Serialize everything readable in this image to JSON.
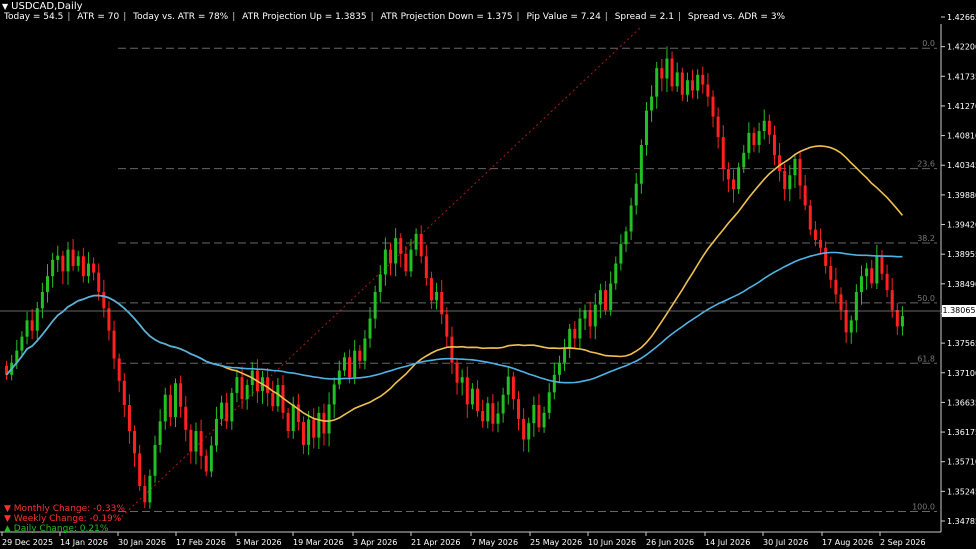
{
  "header": {
    "symbol_title": "USDCAD,Daily",
    "info": [
      "Today = 54.5",
      "ATR = 70",
      "Today vs. ATR = 78%",
      "ATR Projection Up = 1.3835",
      "ATR Projection Down = 1.375",
      "Pip Value = 7.24",
      "Spread = 2.1",
      "Spread vs. ADR = 3%"
    ]
  },
  "changes": {
    "monthly": "Monthly Change: -0.33%",
    "weekly": "Weekly Change: -0.19%",
    "daily": "Daily Change: 0.21%",
    "down_color": "#ff3030",
    "up_color": "#22bb22"
  },
  "current_price": "1.38065",
  "chart_data": {
    "type": "candlestick",
    "title": "USDCAD,Daily",
    "ylim": [
      1.3445,
      1.4295
    ],
    "y_ticks": [
      "1.42665",
      "1.42200",
      "1.41735",
      "1.41270",
      "1.40810",
      "1.40345",
      "1.39880",
      "1.39420",
      "1.38955",
      "1.38490",
      "1.38065",
      "1.37565",
      "1.37100",
      "1.36635",
      "1.36175",
      "1.35710",
      "1.35245",
      "1.34785"
    ],
    "x_labels": [
      "29 Dec 2025",
      "14 Jan 2026",
      "30 Jan 2026",
      "17 Feb 2026",
      "5 Mar 2026",
      "19 Mar 2026",
      "3 Apr 2026",
      "21 Apr 2026",
      "7 May 2026",
      "25 May 2026",
      "10 Jun 2026",
      "26 Jun 2026",
      "14 Jul 2026",
      "30 Jul 2026",
      "17 Aug 2026",
      "2 Sep 2026"
    ],
    "fib_levels": [
      {
        "label": "0.0",
        "price": 1.4245
      },
      {
        "label": "23.6",
        "price": 1.4046
      },
      {
        "label": "38.2",
        "price": 1.3923
      },
      {
        "label": "50.0",
        "price": 1.3824
      },
      {
        "label": "61.8",
        "price": 1.3724
      },
      {
        "label": "100.0",
        "price": 1.3479
      }
    ],
    "closes": [
      1.3705,
      1.3725,
      1.3745,
      1.3768,
      1.3795,
      1.3778,
      1.3815,
      1.3842,
      1.3868,
      1.3895,
      1.3902,
      1.3876,
      1.3912,
      1.3885,
      1.3901,
      1.3868,
      1.3889,
      1.3874,
      1.3842,
      1.3815,
      1.3778,
      1.3732,
      1.3695,
      1.3655,
      1.3612,
      1.3575,
      1.3521,
      1.3494,
      1.3538,
      1.3589,
      1.3628,
      1.3672,
      1.3635,
      1.3691,
      1.3652,
      1.3614,
      1.3578,
      1.3612,
      1.3571,
      1.3545,
      1.3588,
      1.3632,
      1.3659,
      1.3628,
      1.3675,
      1.3701,
      1.3665,
      1.3688,
      1.3712,
      1.3678,
      1.3701,
      1.3675,
      1.3653,
      1.3688,
      1.3642,
      1.3612,
      1.3656,
      1.3627,
      1.3589,
      1.3631,
      1.3601,
      1.3642,
      1.3608,
      1.3656,
      1.3689,
      1.3712,
      1.3734,
      1.3701,
      1.3745,
      1.3728,
      1.3765,
      1.3798,
      1.3842,
      1.3871,
      1.3912,
      1.3889,
      1.3931,
      1.3905,
      1.3876,
      1.3912,
      1.3938,
      1.3901,
      1.3865,
      1.3828,
      1.3842,
      1.3805,
      1.3768,
      1.3725,
      1.3692,
      1.3701,
      1.3656,
      1.3682,
      1.3645,
      1.3628,
      1.3658,
      1.3624,
      1.3641,
      1.3672,
      1.3702,
      1.3665,
      1.3632,
      1.3598,
      1.3625,
      1.3655,
      1.3618,
      1.3642,
      1.3676,
      1.3705,
      1.3725,
      1.3748,
      1.3781,
      1.3765,
      1.3798,
      1.3812,
      1.3785,
      1.3821,
      1.3845,
      1.3812,
      1.3856,
      1.3889,
      1.3921,
      1.3942,
      1.3985,
      1.4021,
      1.4085,
      1.4142,
      1.4165,
      1.4212,
      1.4195,
      1.4228,
      1.4182,
      1.4205,
      1.4168,
      1.4192,
      1.4175,
      1.4201,
      1.4185,
      1.4165,
      1.4132,
      1.4098,
      1.4045,
      1.4028,
      1.4012,
      1.4048,
      1.4072,
      1.4105,
      1.4085,
      1.4108,
      1.4125,
      1.4102,
      1.4068,
      1.4042,
      1.4012,
      1.4035,
      1.4062,
      1.4018,
      1.3985,
      1.3945,
      1.3928,
      1.3915,
      1.3885,
      1.3862,
      1.3838,
      1.3812,
      1.3775,
      1.3795,
      1.3842,
      1.3868,
      1.3881,
      1.3856,
      1.3901,
      1.3872,
      1.3845,
      1.3812,
      1.3785,
      1.3802
    ]
  }
}
